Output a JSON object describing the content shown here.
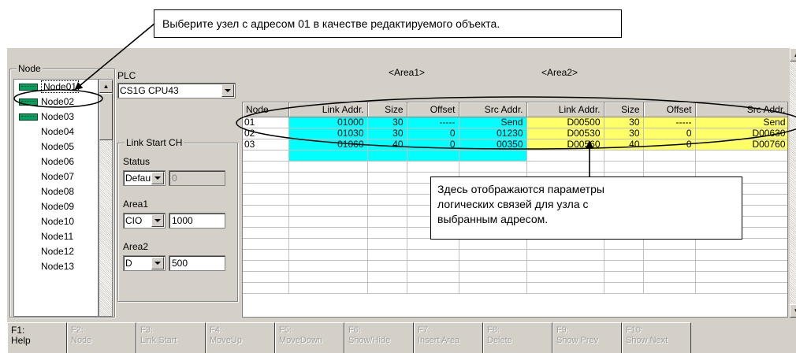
{
  "callouts": {
    "top": "Выберите узел с адресом 01 в качестве редактируемого объекта.",
    "mid_lines": [
      "Здесь отображаются параметры",
      "логических связей для узла с",
      "выбранным адресом."
    ]
  },
  "node_panel": {
    "title": "Node",
    "items": [
      {
        "label": "Node01",
        "icon": true,
        "selected": true
      },
      {
        "label": "Node02",
        "icon": true
      },
      {
        "label": "Node03",
        "icon": true
      },
      {
        "label": "Node04"
      },
      {
        "label": "Node05"
      },
      {
        "label": "Node06"
      },
      {
        "label": "Node07"
      },
      {
        "label": "Node08"
      },
      {
        "label": "Node09"
      },
      {
        "label": "Node10"
      },
      {
        "label": "Node11"
      },
      {
        "label": "Node12"
      },
      {
        "label": "Node13"
      }
    ]
  },
  "plc": {
    "label": "PLC",
    "value": "CS1G CPU43"
  },
  "link_start": {
    "title": "Link Start CH",
    "status_label": "Status",
    "status_value": "Default",
    "status_text": "0",
    "area1_label": "Area1",
    "area1_type": "CIO",
    "area1_value": "1000",
    "area2_label": "Area2",
    "area2_type": "D",
    "area2_value": "500"
  },
  "grid": {
    "area1_title": "<Area1>",
    "area2_title": "<Area2>",
    "columns": [
      "Node",
      "Link Addr.",
      "Size",
      "Offset",
      "Src Addr.",
      "Link Addr.",
      "Size",
      "Offset",
      "Src Addr."
    ],
    "rows": [
      [
        "01",
        "01000",
        "30",
        "-----",
        "Send",
        "D00500",
        "30",
        "-----",
        "Send"
      ],
      [
        "02",
        "01030",
        "30",
        "0",
        "01230",
        "D00530",
        "30",
        "0",
        "D00630"
      ],
      [
        "03",
        "01060",
        "40",
        "0",
        "00350",
        "D00560",
        "40",
        "0",
        "D00760"
      ]
    ]
  },
  "fkeys": [
    {
      "key": "F1:",
      "label": "Help",
      "enabled": true
    },
    {
      "key": "F2:",
      "label": "Node",
      "enabled": false
    },
    {
      "key": "F3:",
      "label": "Link Start",
      "enabled": false
    },
    {
      "key": "F4:",
      "label": "MoveUp",
      "enabled": false
    },
    {
      "key": "F5:",
      "label": "MoveDown",
      "enabled": false
    },
    {
      "key": "F6:",
      "label": "Show/Hide",
      "enabled": false
    },
    {
      "key": "F7:",
      "label": "Insert Area",
      "enabled": false
    },
    {
      "key": "F8:",
      "label": "Delete",
      "enabled": false
    },
    {
      "key": "F9:",
      "label": "Show Prev",
      "enabled": false
    },
    {
      "key": "F10:",
      "label": "Show Next",
      "enabled": false
    }
  ],
  "colors": {
    "area1_highlight": "#00ffff",
    "area2_highlight": "#ffff66",
    "window_face": "#d4d0c8"
  }
}
